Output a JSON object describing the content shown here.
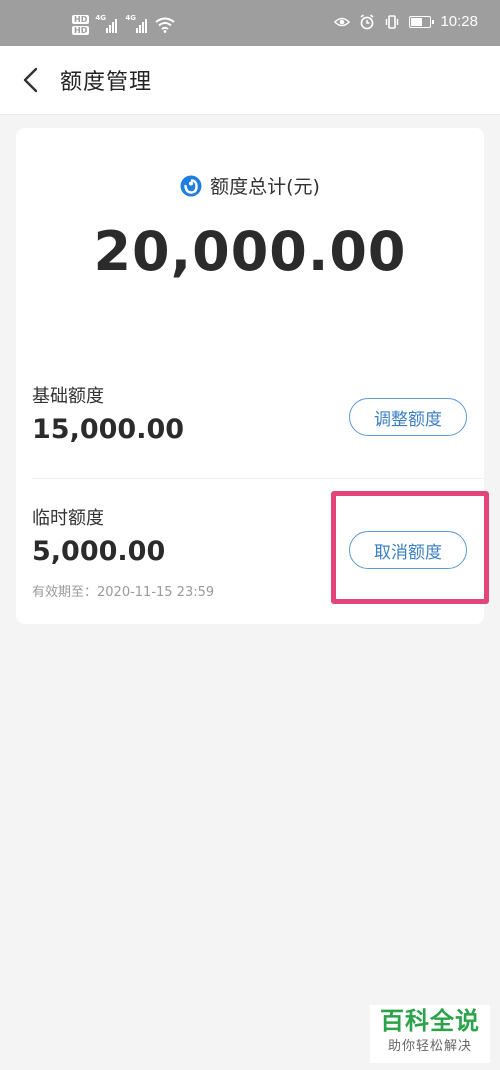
{
  "status_bar": {
    "hd_top": "HD",
    "hd_bottom": "HD",
    "net1": "4G",
    "net2": "4G",
    "time": "10:28",
    "battery_level": 0.55
  },
  "header": {
    "back_icon": "chevron-left-icon",
    "title": "额度管理"
  },
  "total": {
    "icon": "brand-logo-icon",
    "label": "额度总计(元)",
    "amount": "20,000.00"
  },
  "base_quota": {
    "label": "基础额度",
    "amount": "15,000.00",
    "button": "调整额度"
  },
  "temp_quota": {
    "label": "临时额度",
    "amount": "5,000.00",
    "button": "取消额度",
    "expiry": "有效期至：2020-11-15 23:59"
  },
  "colors": {
    "accent": "#3b7fc4",
    "highlight": "#e3457a",
    "watermark": "#2aa34a"
  },
  "watermark": {
    "title": "百科全说",
    "subtitle": "助你轻松解决"
  }
}
